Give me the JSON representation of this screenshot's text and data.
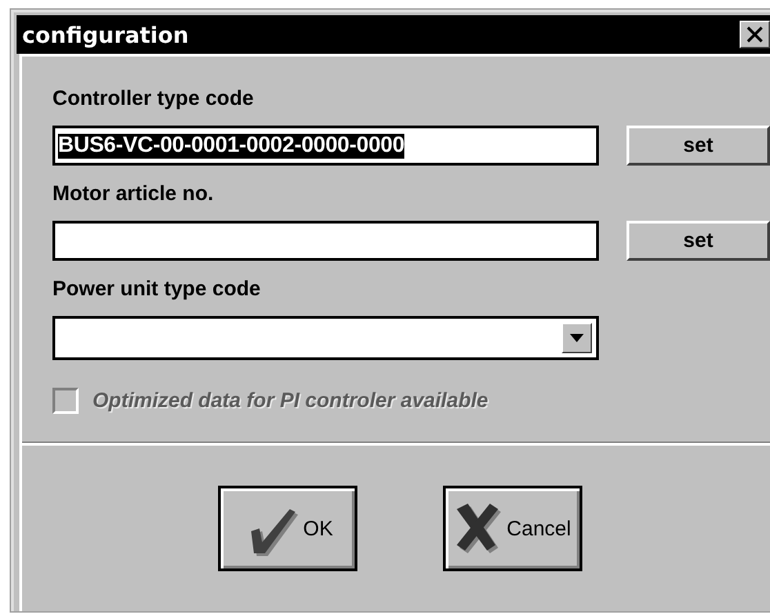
{
  "window": {
    "title": "configuration"
  },
  "fields": [
    {
      "kind": "text",
      "label": "Controller type code",
      "value": "BUS6-VC-00-0001-0002-0000-0000",
      "highlighted": true,
      "button": "set"
    },
    {
      "kind": "text",
      "label": "Motor article no.",
      "button": "set"
    },
    {
      "kind": "dropdown",
      "label": "Power unit type code"
    }
  ],
  "checkbox": {
    "label": "Optimized data for PI controler available",
    "checked": false,
    "disabled": true
  },
  "buttons": [
    {
      "kind": "ok",
      "label": "OK"
    },
    {
      "kind": "cancel",
      "label": "Cancel"
    }
  ]
}
